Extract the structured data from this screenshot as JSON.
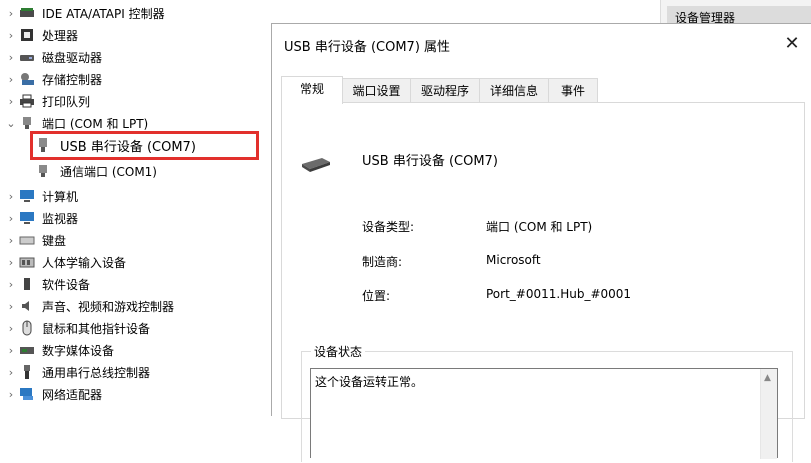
{
  "tree": {
    "items": [
      {
        "label": "IDE ATA/ATAPI 控制器",
        "icon": "ide-controller-icon",
        "expanded": false
      },
      {
        "label": "处理器",
        "icon": "processor-icon",
        "expanded": false
      },
      {
        "label": "磁盘驱动器",
        "icon": "disk-drive-icon",
        "expanded": false
      },
      {
        "label": "存储控制器",
        "icon": "storage-controller-icon",
        "expanded": false
      },
      {
        "label": "打印队列",
        "icon": "printer-icon",
        "expanded": false
      },
      {
        "label": "端口 (COM 和 LPT)",
        "icon": "port-icon",
        "expanded": true
      },
      {
        "label": "计算机",
        "icon": "computer-icon",
        "expanded": false
      },
      {
        "label": "监视器",
        "icon": "monitor-icon",
        "expanded": false
      },
      {
        "label": "键盘",
        "icon": "keyboard-icon",
        "expanded": false
      },
      {
        "label": "人体学输入设备",
        "icon": "hid-icon",
        "expanded": false
      },
      {
        "label": "软件设备",
        "icon": "software-device-icon",
        "expanded": false
      },
      {
        "label": "声音、视频和游戏控制器",
        "icon": "sound-icon",
        "expanded": false
      },
      {
        "label": "鼠标和其他指针设备",
        "icon": "mouse-icon",
        "expanded": false
      },
      {
        "label": "数字媒体设备",
        "icon": "digital-media-icon",
        "expanded": false
      },
      {
        "label": "通用串行总线控制器",
        "icon": "usb-controller-icon",
        "expanded": false
      },
      {
        "label": "网络适配器",
        "icon": "network-adapter-icon",
        "expanded": false
      }
    ],
    "port_children": [
      {
        "label": "USB 串行设备 (COM7)",
        "icon": "serial-port-icon",
        "highlighted": true
      },
      {
        "label": "通信端口 (COM1)",
        "icon": "serial-port-icon",
        "highlighted": false
      }
    ]
  },
  "device_manager": {
    "title": "设备管理器"
  },
  "dialog": {
    "title": "USB 串行设备 (COM7) 属性",
    "close_glyph": "✕",
    "tabs": [
      "常规",
      "端口设置",
      "驱动程序",
      "详细信息",
      "事件"
    ],
    "active_tab": "常规",
    "device_name": "USB 串行设备 (COM7)",
    "properties": {
      "type_label": "设备类型:",
      "type_value": "端口 (COM 和 LPT)",
      "mfr_label": "制造商:",
      "mfr_value": "Microsoft",
      "loc_label": "位置:",
      "loc_value": "Port_#0011.Hub_#0001"
    },
    "status": {
      "legend": "设备状态",
      "text": "这个设备运转正常。",
      "scroll_up_glyph": "▲"
    }
  },
  "colors": {
    "highlight_border": "#e2302c",
    "title_bar": "#dcdcdc"
  }
}
